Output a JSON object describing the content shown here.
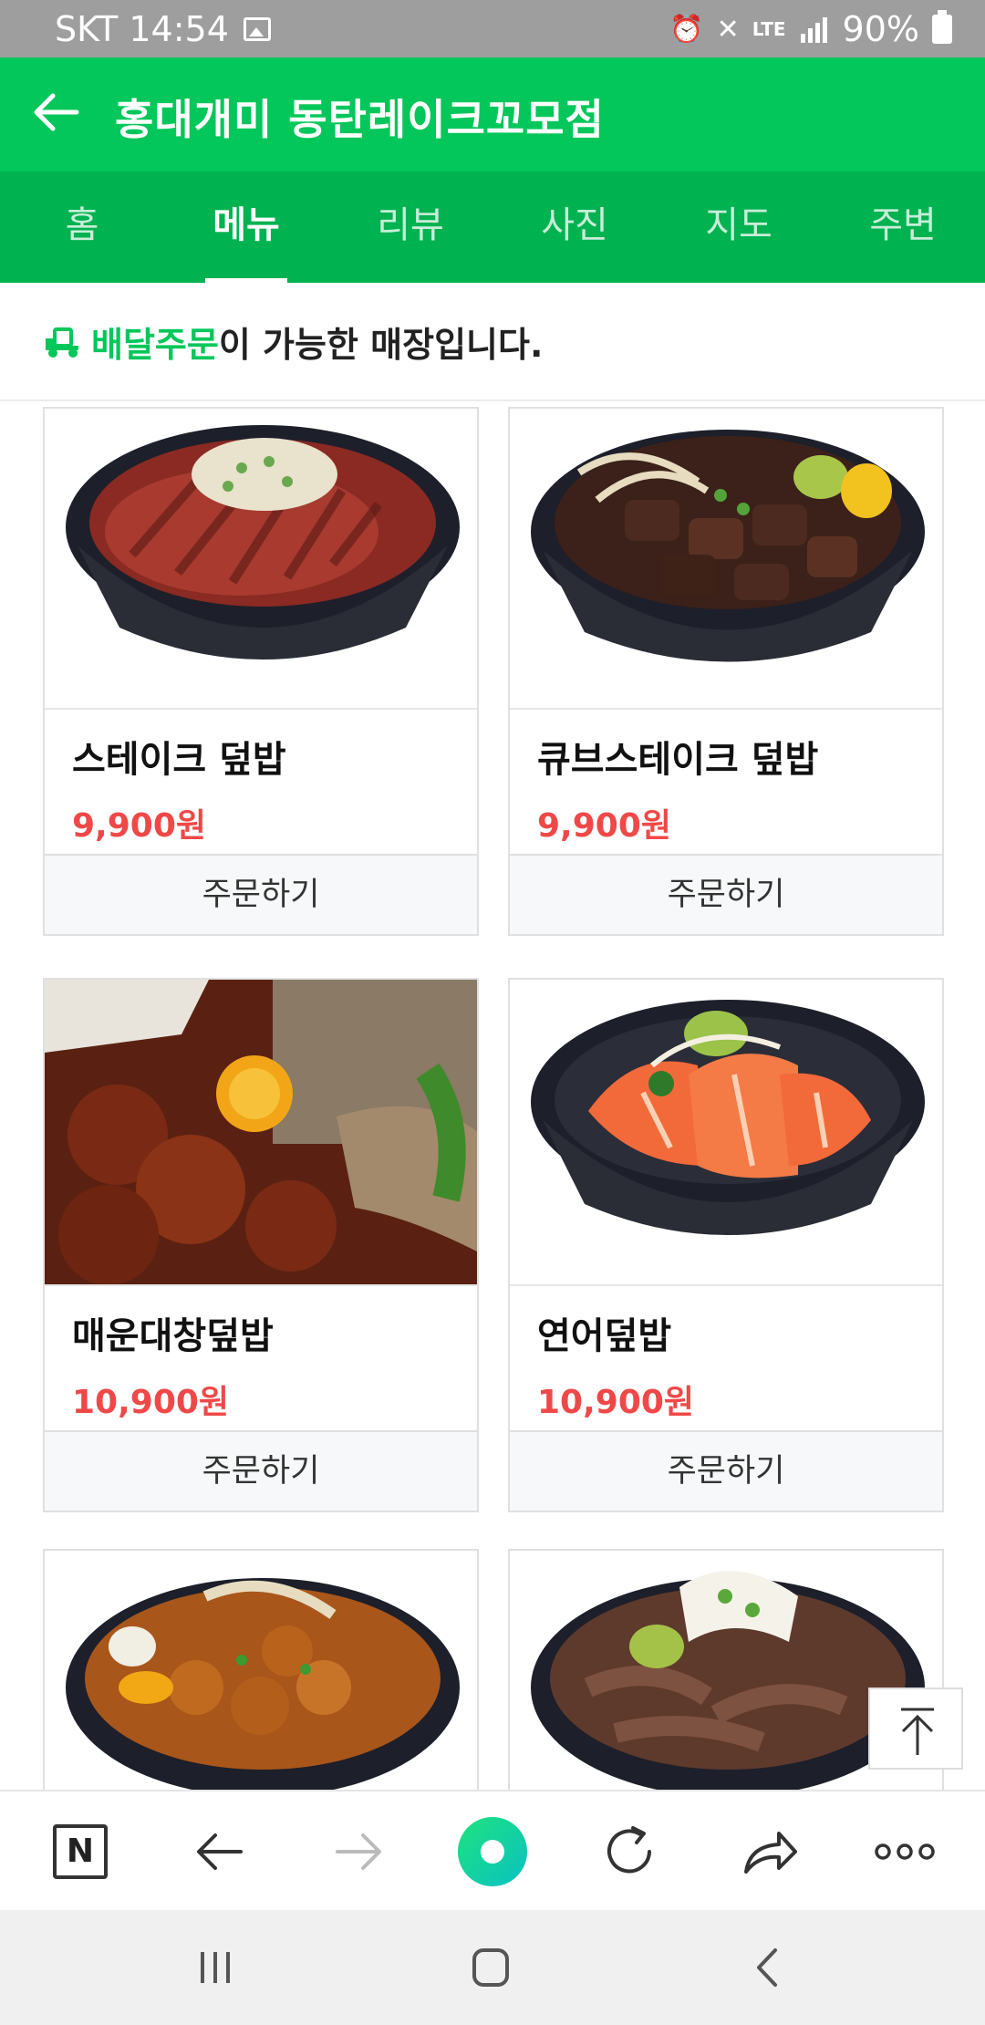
{
  "status_bar": {
    "carrier_time": "SKT 14:54",
    "network": "LTE",
    "battery": "90%"
  },
  "header": {
    "title": "홍대개미 동탄레이크꼬모점"
  },
  "tabs": [
    {
      "label": "홈",
      "active": false
    },
    {
      "label": "메뉴",
      "active": true
    },
    {
      "label": "리뷰",
      "active": false
    },
    {
      "label": "사진",
      "active": false
    },
    {
      "label": "지도",
      "active": false
    },
    {
      "label": "주변",
      "active": false
    }
  ],
  "delivery_banner": {
    "highlight": "배달주문",
    "text": "이 가능한 매장입니다."
  },
  "menu_items": [
    {
      "name": "스테이크 덮밥",
      "price": "9,900원",
      "order_label": "주문하기"
    },
    {
      "name": "큐브스테이크 덮밥",
      "price": "9,900원",
      "order_label": "주문하기"
    },
    {
      "name": "매운대창덮밥",
      "price": "10,900원",
      "order_label": "주문하기"
    },
    {
      "name": "연어덮밥",
      "price": "10,900원",
      "order_label": "주문하기"
    }
  ],
  "colors": {
    "brand_green": "#03c75a",
    "tab_green": "#00b250",
    "price_red": "#f04848"
  },
  "icons": [
    "back-arrow-icon",
    "truck-icon",
    "scroll-top-icon",
    "naver-n-icon",
    "browser-back-icon",
    "browser-forward-icon",
    "green-home-icon",
    "refresh-icon",
    "share-icon",
    "more-icon",
    "recent-apps-icon",
    "home-button-icon",
    "nav-back-icon"
  ]
}
